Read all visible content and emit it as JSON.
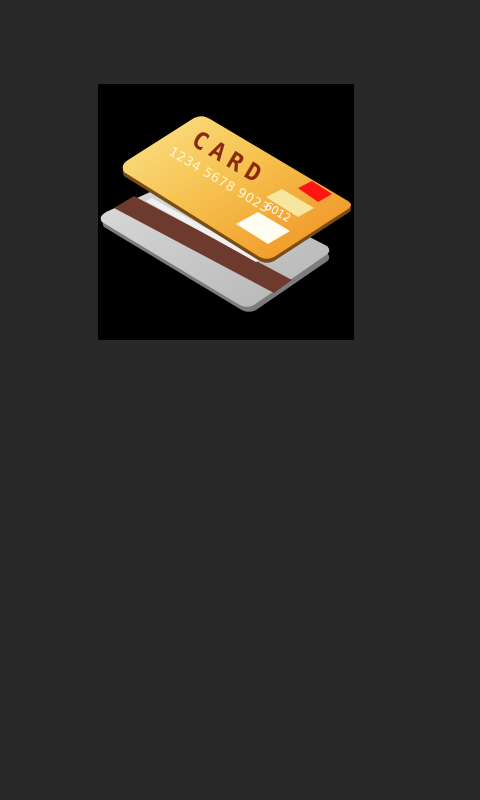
{
  "screen": {
    "background": "#282828"
  },
  "image": {
    "subject": "credit-card-icon",
    "frame_color": "#000000",
    "card_front": {
      "title": "CARD",
      "number": "1234 5678 9023",
      "expiry": "6012",
      "gradient_light": "#f8d870",
      "gradient_dark": "#f09420",
      "text_color": "#8a2a10",
      "number_color": "#fff6d0",
      "chip_color": "#ff1010",
      "hologram_color": "#f8e8a0",
      "signature_color": "#fffdf0"
    },
    "card_back": {
      "body_color": "#c8c8c8",
      "stripe_color": "#6e3a2e",
      "edge_color": "#8e8e8e"
    }
  }
}
